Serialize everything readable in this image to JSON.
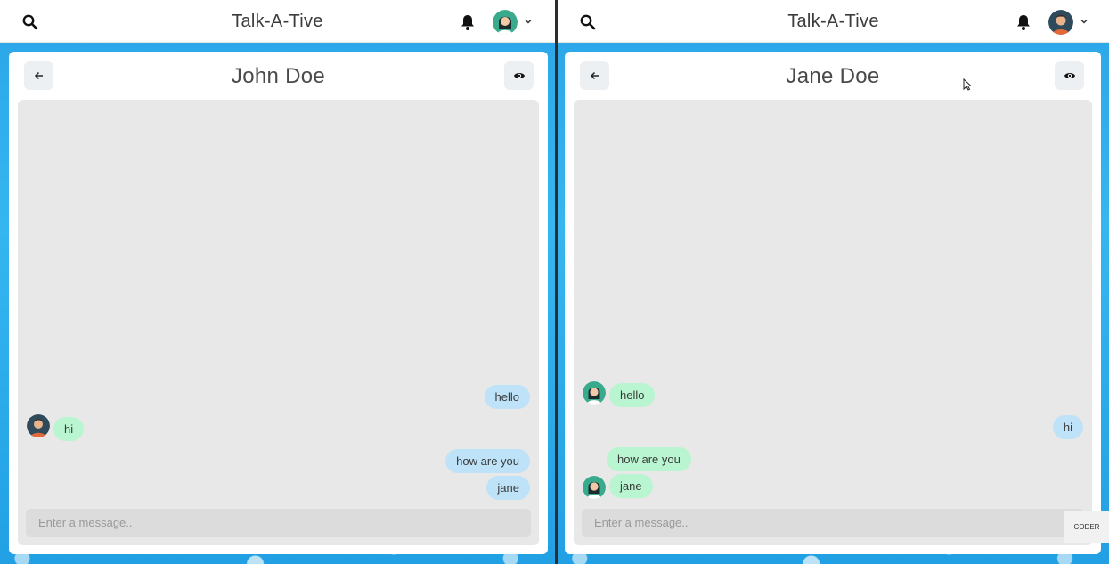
{
  "panes": [
    {
      "app_title": "Talk-A-Tive",
      "chat_name": "John Doe",
      "input_placeholder": "Enter a message..",
      "messages": [
        "hello",
        "hi",
        "how are you",
        "jane"
      ]
    },
    {
      "app_title": "Talk-A-Tive",
      "chat_name": "Jane Doe",
      "input_placeholder": "Enter a message..",
      "messages": [
        "hello",
        "hi",
        "how are you",
        "jane"
      ],
      "watermark": "CODER"
    }
  ],
  "icons": {
    "search": "search-icon",
    "notifications": "bell-icon",
    "profile": "avatar",
    "menu": "chevron-down-icon",
    "back": "arrow-left-icon",
    "view_profile": "eye-icon"
  },
  "colors": {
    "background_blue": "#2aa5e8",
    "sent_bubble": "#bee3f8",
    "received_bubble": "#b9f5d0",
    "message_area": "#e8e8e8"
  }
}
